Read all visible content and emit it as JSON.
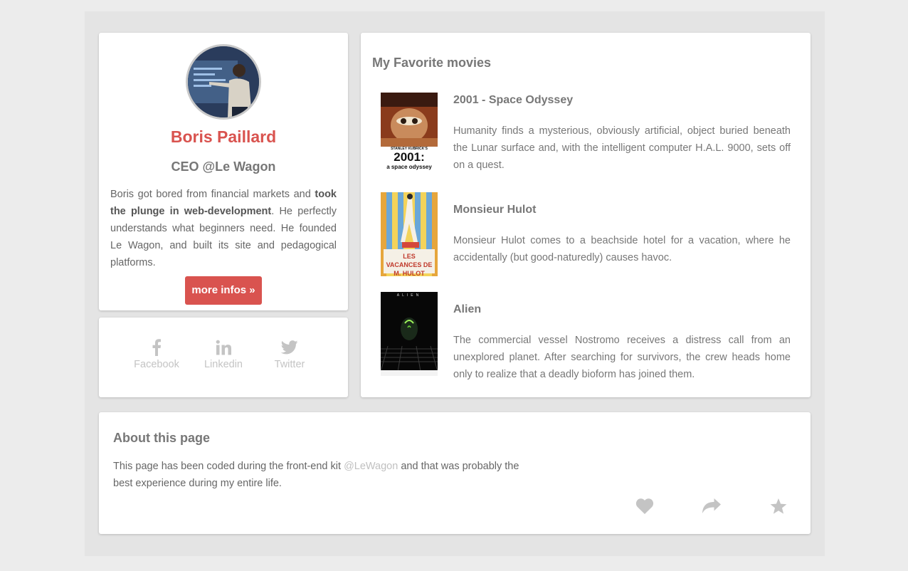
{
  "profile": {
    "name": "Boris Paillard",
    "role": "CEO @Le Wagon",
    "bio_part1": "Boris got bored from financial markets and",
    "bio_bold": "took the plunge in web-development",
    "bio_part2": ". He perfectly understands what beginners need. He founded Le Wagon, and built its site and pedagogical platforms.",
    "more_button": "more infos »"
  },
  "social": [
    {
      "label": "Facebook",
      "icon": "facebook-icon"
    },
    {
      "label": "Linkedin",
      "icon": "linkedin-icon"
    },
    {
      "label": "Twitter",
      "icon": "twitter-icon"
    }
  ],
  "movies": {
    "title": "My Favorite movies",
    "items": [
      {
        "title": "2001 - Space Odyssey",
        "description": "Humanity finds a mysterious, obviously artificial, object buried beneath the Lunar surface and, with the intelligent computer H.A.L. 9000, sets off on a quest.",
        "poster_top": "STANLEY KUBRICK'S",
        "poster_main": "2001:",
        "poster_sub": "a space odyssey"
      },
      {
        "title": "Monsieur Hulot",
        "description": "Monsieur Hulot comes to a beachside hotel for a vacation, where he accidentally (but good-naturedly) causes havoc.",
        "poster_text": "LES VACANCES DE M. HULOT"
      },
      {
        "title": "Alien",
        "description": "The commercial vessel Nostromo receives a distress call from an unexplored planet. After searching for survivors, the crew heads home only to realize that a deadly bioform has joined them.",
        "poster_text": "ALIEN"
      }
    ]
  },
  "about": {
    "title": "About this page",
    "text_before": "This page has been coded during the front-end kit ",
    "link": "@LeWagon",
    "text_after": " and that was probably the best experience during my entire life."
  },
  "actions": [
    "heart-icon",
    "share-icon",
    "star-icon"
  ],
  "colors": {
    "accent": "#d9534f",
    "icon_gray": "#c4c4c4",
    "background": "#e4e4e4"
  }
}
